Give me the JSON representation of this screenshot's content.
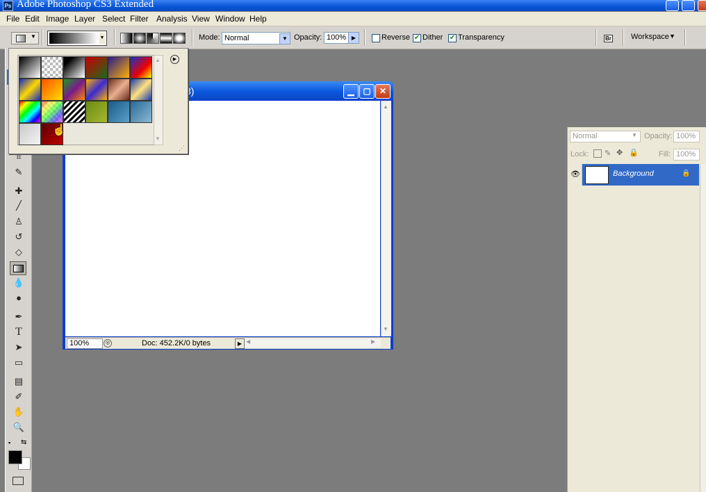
{
  "window": {
    "title": "Adobe Photoshop CS3 Extended",
    "app_icon": "Ps"
  },
  "menu": [
    "File",
    "Edit",
    "Image",
    "Layer",
    "Select",
    "Filter",
    "Analysis",
    "View",
    "Window",
    "Help"
  ],
  "options": {
    "mode_label": "Mode:",
    "mode_value": "Normal",
    "opacity_label": "Opacity:",
    "opacity_value": "100%",
    "reverse_label": "Reverse",
    "reverse_checked": false,
    "dither_label": "Dither",
    "dither_checked": true,
    "transparency_label": "Transparency",
    "transparency_checked": true,
    "bridge_icon": "Br",
    "workspace_label": "Workspace"
  },
  "document": {
    "title_partial": "8)",
    "zoom": "100%",
    "doc_info": "Doc: 452.2K/0 bytes"
  },
  "gradient_picker": {
    "swatches": [
      "linear-gradient(135deg,#000,#fff)",
      "repeating-conic-gradient(#bbb 0 25%,#fff 0 50%) 0 0/8px 8px",
      "linear-gradient(135deg,#000 20%,#fff)",
      "linear-gradient(135deg,#c00,#1a6b1a)",
      "linear-gradient(135deg,#2a1a8c,#ffb000)",
      "linear-gradient(135deg,#1530c8,#e00 60%,#ff0)",
      "linear-gradient(135deg,#1428c8,#ffd800 50%,#1428c8)",
      "linear-gradient(135deg,#ff5000,#ffe000)",
      "linear-gradient(135deg,#1a9a2a,#7a1a8a,#ff8a00)",
      "linear-gradient(135deg,#ffb000,#3a2ad0,#ffb000)",
      "linear-gradient(135deg,#6a2a1a,#e8b090,#6a2a1a)",
      "linear-gradient(135deg,#1a3ab0,#ffe080,#1a3ab0)",
      "linear-gradient(135deg,#f00,#ff0,#0f0,#0ff,#00f,#f0f)",
      "linear-gradient(135deg,#f008,#ff08,#0f08,#00f8,#f0f8),repeating-conic-gradient(#ccc 0 25%,#fff 0 50%) 0 0/8px 8px",
      "repeating-linear-gradient(135deg,#000 0 3px,#fff 3px 6px)",
      "linear-gradient(135deg,#6a8a10,#a8b830)",
      "linear-gradient(135deg,#1a5a8a,#5aa0c8)",
      "linear-gradient(135deg,#2a6a9a,#8ab8d0)",
      "linear-gradient(135deg,#c8c8c8,#f4f4f4)",
      "linear-gradient(135deg,#5a0000,#c00000)"
    ]
  },
  "layers": {
    "blend_mode": "Normal",
    "opacity_label": "Opacity:",
    "opacity_value": "100%",
    "lock_label": "Lock:",
    "fill_label": "Fill:",
    "fill_value": "100%",
    "layer_name": "Background"
  },
  "colors": {
    "titlebar": "#0854d6",
    "workspace": "#7c7c7c",
    "selected_layer": "#3169c6"
  }
}
